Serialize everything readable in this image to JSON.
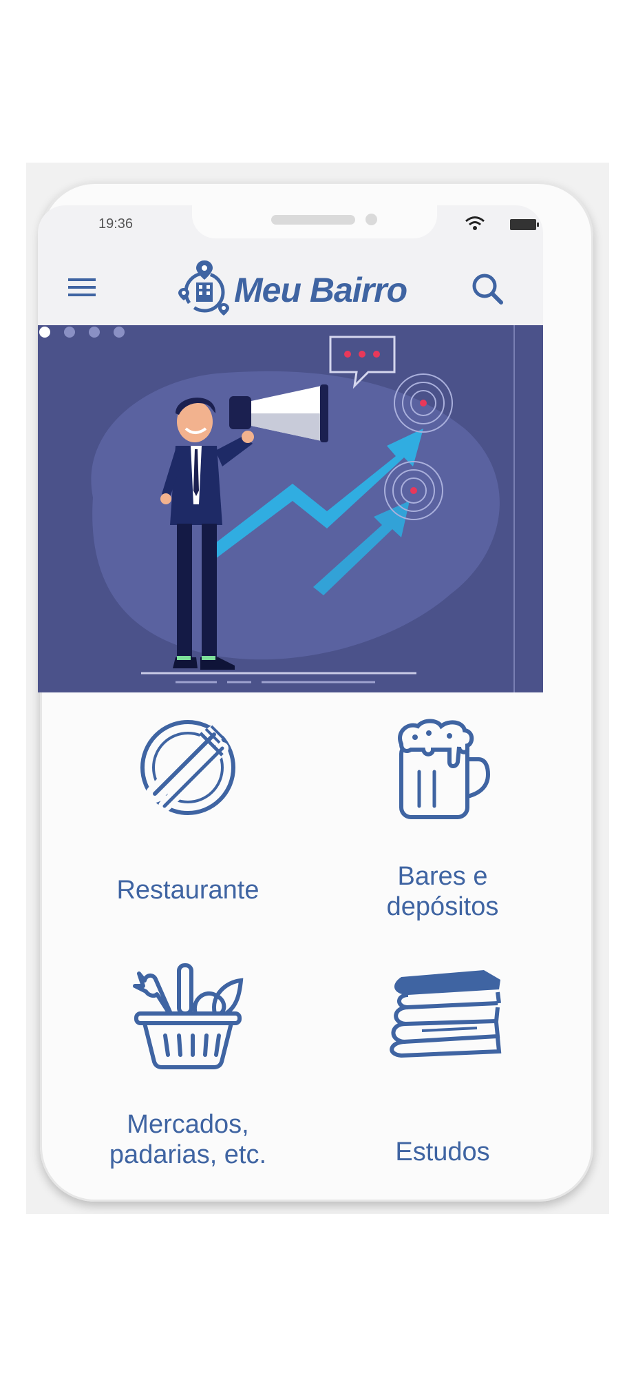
{
  "status_bar": {
    "time": "19:36"
  },
  "app_bar": {
    "title": "Meu Bairro"
  },
  "banner": {
    "pages": 4,
    "active_page": 1
  },
  "categories": [
    {
      "label_lines": [
        "Restaurante"
      ],
      "icon": "plate-fork-knife-icon"
    },
    {
      "label_lines": [
        "Bares e",
        "depósitos"
      ],
      "icon": "beer-mug-icon"
    },
    {
      "label_lines": [
        "Mercados,",
        "padarias, etc."
      ],
      "icon": "grocery-basket-icon"
    },
    {
      "label_lines": [
        "Estudos"
      ],
      "icon": "books-icon"
    }
  ],
  "colors": {
    "brand": "#3f64a2",
    "banner_bg": "#4b528a",
    "app_bar_bg": "#f2f2f4",
    "accent_arrow": "#29c3f0",
    "alert_dot": "#e8385a"
  }
}
